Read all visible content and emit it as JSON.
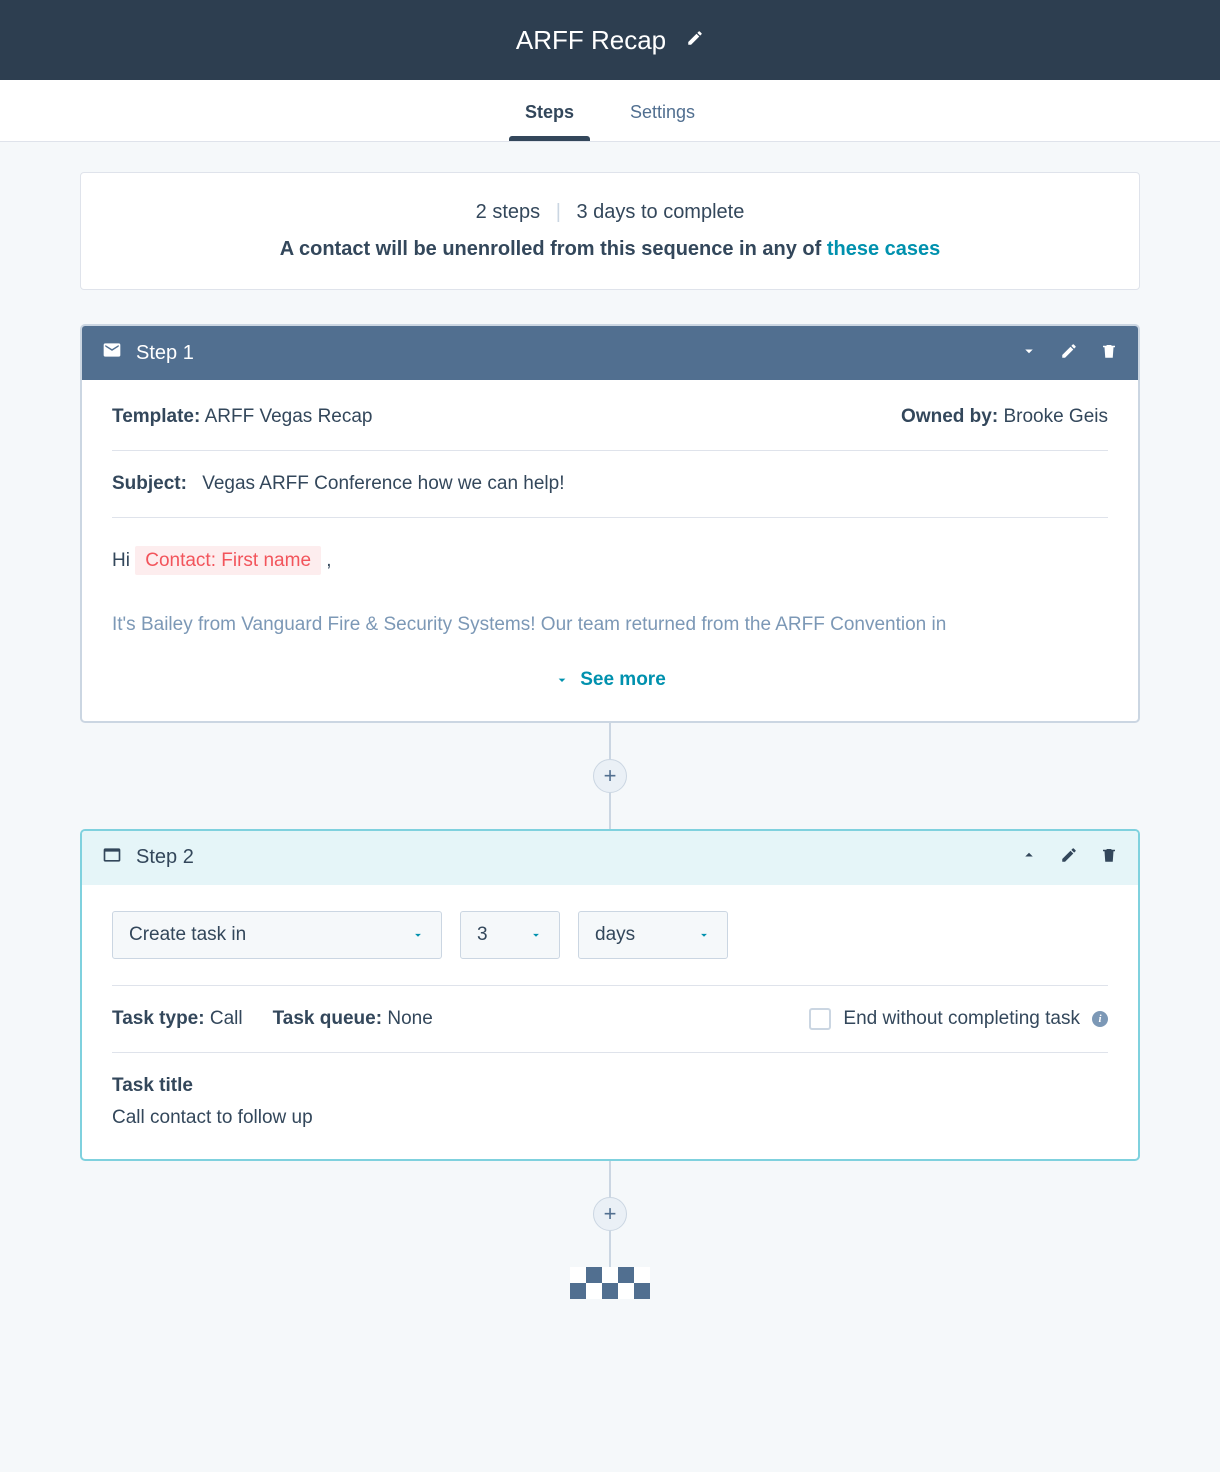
{
  "header": {
    "title": "ARFF Recap"
  },
  "tabs": {
    "steps": "Steps",
    "settings": "Settings"
  },
  "summary": {
    "steps_count": "2 steps",
    "days": "3 days to complete",
    "unenroll_prefix": "A contact will be unenrolled from this sequence in any of ",
    "unenroll_link": "these cases"
  },
  "step1": {
    "label": "Step 1",
    "template_label": "Template:",
    "template_value": "ARFF Vegas Recap",
    "owned_label": "Owned by:",
    "owned_value": "Brooke Geis",
    "subject_label": "Subject:",
    "subject_value": "Vegas ARFF Conference how we can help!",
    "body_greeting": "Hi ",
    "token": "Contact: First name",
    "body_after_token": " ,",
    "body_para2": "It's Bailey from Vanguard Fire & Security Systems! Our team returned from the ARFF Convention in",
    "see_more": "See more"
  },
  "step2": {
    "label": "Step 2",
    "select_action": "Create task in",
    "select_num": "3",
    "select_unit": "days",
    "task_type_label": "Task type:",
    "task_type_value": "Call",
    "task_queue_label": "Task queue:",
    "task_queue_value": "None",
    "end_without_label": "End without completing task",
    "task_title_label": "Task title",
    "task_title_value": "Call contact to follow up"
  }
}
